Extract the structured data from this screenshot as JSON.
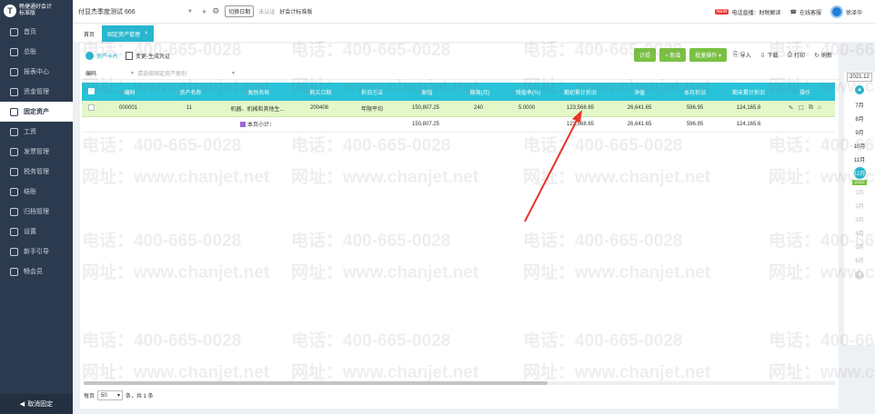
{
  "app": {
    "logo_mark": "T",
    "logo_line1": "畅捷通好会计",
    "logo_line2": "标准版"
  },
  "sidebar": {
    "items": [
      {
        "label": "首页",
        "icon": "home-icon"
      },
      {
        "label": "总账",
        "icon": "ledger-icon"
      },
      {
        "label": "报表中心",
        "icon": "report-icon"
      },
      {
        "label": "资金管理",
        "icon": "money-icon"
      },
      {
        "label": "固定资产",
        "icon": "asset-icon",
        "active": true
      },
      {
        "label": "工资",
        "icon": "salary-icon"
      },
      {
        "label": "发票管理",
        "icon": "invoice-icon"
      },
      {
        "label": "税务管理",
        "icon": "tax-icon"
      },
      {
        "label": "结账",
        "icon": "closing-icon"
      },
      {
        "label": "归档管理",
        "icon": "archive-icon"
      },
      {
        "label": "设置",
        "icon": "settings-icon"
      },
      {
        "label": "新手引导",
        "icon": "guide-icon"
      },
      {
        "label": "畅会员",
        "icon": "vip-icon"
      }
    ],
    "bottom_label": "取消固定"
  },
  "topbar": {
    "company": "付显杰季度测试 666",
    "switch_label": "切换日期",
    "unverified": "未认证",
    "standard": "好会计标准版",
    "notice_badge": "NEW",
    "notice_label": "电话直播：财税解读",
    "service_label": "在线客服",
    "user_name": "徐泽华"
  },
  "tabs": [
    {
      "label": "首页"
    },
    {
      "label": "固定资产管理",
      "close": "×"
    }
  ],
  "toolbar": {
    "tab_card": "资产卡片",
    "tab_voucher": "变更-生成凭证",
    "btn_depreciate": "计提",
    "btn_add": "+ 新增",
    "btn_batch": "批量操作 ▾",
    "btn_import": "导入",
    "btn_download": "下载",
    "btn_print": "打印",
    "btn_refresh": "刷新"
  },
  "filter": {
    "select": "编码",
    "placeholder": "请选择固定资产类别"
  },
  "table": {
    "headers": [
      "编码",
      "资产名称",
      "类别名称",
      "购买日期",
      "折旧方法",
      "原值",
      "期限(月)",
      "残值率(%)",
      "期初累计折旧",
      "净值",
      "本月折旧",
      "期末累计折旧",
      "操作"
    ],
    "required": [
      true,
      true,
      true,
      true,
      false,
      true,
      true,
      true,
      false,
      false,
      false,
      false,
      false
    ],
    "rows": [
      [
        "000001",
        "11",
        "机器、机械和其他生...",
        "200408",
        "年限平均",
        "150,807.25",
        "240",
        "5.0000",
        "123,568.65",
        "26,641.65",
        "596.95",
        "124,165.6"
      ]
    ],
    "subtotal": {
      "label": "本页小计：",
      "original": "150,807.25",
      "opening_dep": "123,568.65",
      "net": "26,641.65",
      "month_dep": "596.95",
      "closing_dep": "124,165.6"
    }
  },
  "pager": {
    "prefix": "每页",
    "size": "50",
    "suffix": "条，共 1 条"
  },
  "months": {
    "year": "2021.12",
    "list": [
      "7月",
      "8月",
      "9月",
      "10月",
      "11月",
      "12月",
      "1月",
      "2月",
      "3月",
      "4月",
      "5月",
      "6月"
    ],
    "current": "12月",
    "year_tag": "2022"
  },
  "watermark": {
    "phone": "电话：400-665-0028",
    "site": "网址：www.chanjet.net"
  }
}
